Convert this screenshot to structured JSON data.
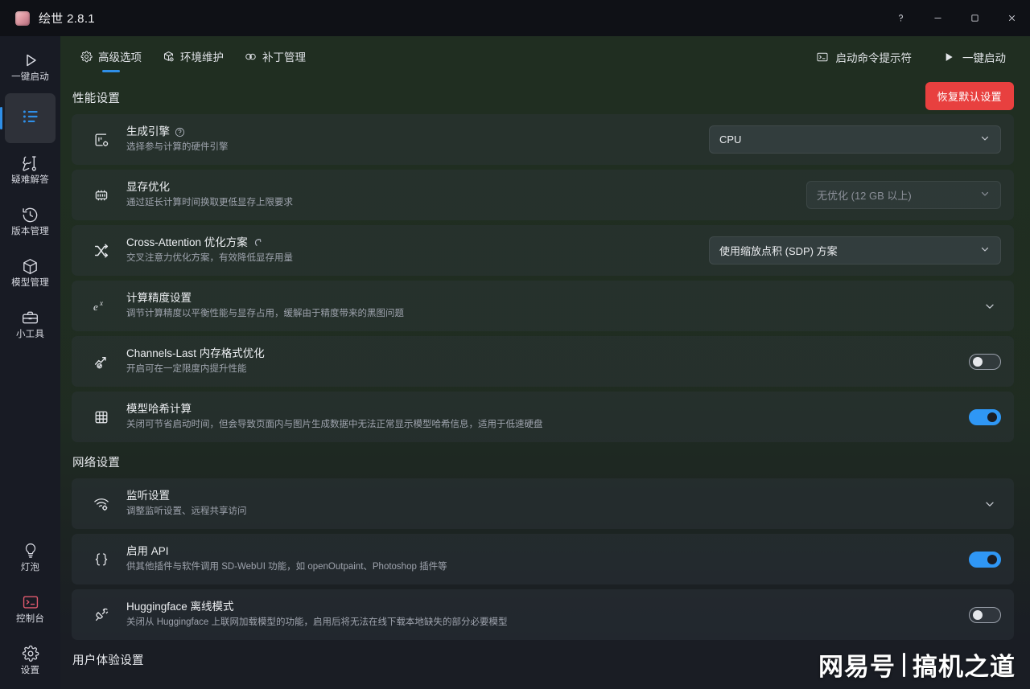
{
  "titlebar": {
    "app_title": "绘世 2.8.1",
    "logo_icon": "app-logo-icon",
    "buttons": [
      {
        "name": "help-button",
        "icon": "question-mark-icon",
        "label": "?"
      },
      {
        "name": "minimize-button",
        "icon": "minimize-icon",
        "label": "─"
      },
      {
        "name": "maximize-button",
        "icon": "maximize-icon",
        "label": "□"
      },
      {
        "name": "close-button",
        "icon": "close-icon",
        "label": "✕"
      }
    ]
  },
  "sidebar": {
    "items": [
      {
        "label": "一键启动",
        "icon": "play-triangle-icon",
        "active": false
      },
      {
        "label": "",
        "icon": "list-settings-icon",
        "active": true
      },
      {
        "label": "疑难解答",
        "icon": "wrench-screwdriver-icon",
        "active": false
      },
      {
        "label": "版本管理",
        "icon": "history-clock-icon",
        "active": false
      },
      {
        "label": "模型管理",
        "icon": "cube-box-icon",
        "active": false
      },
      {
        "label": "小工具",
        "icon": "toolbox-icon",
        "active": false
      }
    ],
    "bottom_items": [
      {
        "label": "灯泡",
        "icon": "lightbulb-icon",
        "active": false
      },
      {
        "label": "控制台",
        "icon": "terminal-icon",
        "active": false
      },
      {
        "label": "设置",
        "icon": "gear-icon",
        "active": false
      }
    ]
  },
  "toolbar": {
    "tabs": [
      {
        "label": "高级选项",
        "icon": "gear-icon",
        "active": true
      },
      {
        "label": "环境维护",
        "icon": "package-maintenance-icon",
        "active": false
      },
      {
        "label": "补丁管理",
        "icon": "patch-icon",
        "active": false
      }
    ],
    "actions": [
      {
        "label": "启动命令提示符",
        "icon": "terminal-window-icon"
      },
      {
        "label": "一键启动",
        "icon": "play-triangle-icon"
      }
    ]
  },
  "sections": [
    {
      "title": "性能设置",
      "reset_label": "恢复默认设置",
      "rows": [
        {
          "icon": "generation-engine-icon",
          "title": "生成引擎",
          "has_help": true,
          "subtitle": "选择参与计算的硬件引擎",
          "control": "select",
          "value": "CPU",
          "disabled": false
        },
        {
          "icon": "vram-chip-icon",
          "title": "显存优化",
          "has_help": false,
          "subtitle": "通过延长计算时间换取更低显存上限要求",
          "control": "select",
          "value": "无优化 (12 GB 以上)",
          "disabled": true
        },
        {
          "icon": "shuffle-arrows-icon",
          "title": "Cross-Attention 优化方案",
          "has_revert": true,
          "subtitle": "交叉注意力优化方案，有效降低显存用量",
          "control": "select",
          "value": "使用缩放点积 (SDP) 方案",
          "disabled": false
        },
        {
          "icon": "exponent-precision-icon",
          "title": "计算精度设置",
          "subtitle": "调节计算精度以平衡性能与显存占用，缓解由于精度带来的黑图问题",
          "control": "expand",
          "value": ""
        },
        {
          "icon": "trend-check-icon",
          "title": "Channels-Last 内存格式优化",
          "subtitle": "开启可在一定限度内提升性能",
          "control": "toggle",
          "value": "off"
        },
        {
          "icon": "hash-grid-icon",
          "title": "模型哈希计算",
          "subtitle": "关闭可节省启动时间，但会导致页面内与图片生成数据中无法正常显示模型哈希信息，适用于低速硬盘",
          "control": "toggle",
          "value": "on"
        }
      ]
    },
    {
      "title": "网络设置",
      "rows": [
        {
          "icon": "wifi-settings-icon",
          "title": "监听设置",
          "subtitle": "调整监听设置、远程共享访问",
          "control": "expand",
          "value": ""
        },
        {
          "icon": "curly-braces-icon",
          "title": "启用 API",
          "subtitle": "供其他插件与软件调用 SD-WebUI 功能，如 openOutpaint、Photoshop 插件等",
          "control": "toggle",
          "value": "on"
        },
        {
          "icon": "unplugged-icon",
          "title": "Huggingface 离线模式",
          "subtitle": "关闭从 Huggingface 上联网加载模型的功能，启用后将无法在线下载本地缺失的部分必要模型",
          "control": "toggle",
          "value": "off"
        }
      ]
    },
    {
      "title": "用户体验设置",
      "rows": []
    }
  ],
  "watermark": {
    "left": "网易号",
    "right": "搞机之道"
  },
  "colors": {
    "accent_blue": "#2f8fe8",
    "toggle_on": "#2f97f5",
    "danger_red": "#e8403f",
    "sidebar_bg": "#181b24",
    "content_tint": "#203021"
  }
}
